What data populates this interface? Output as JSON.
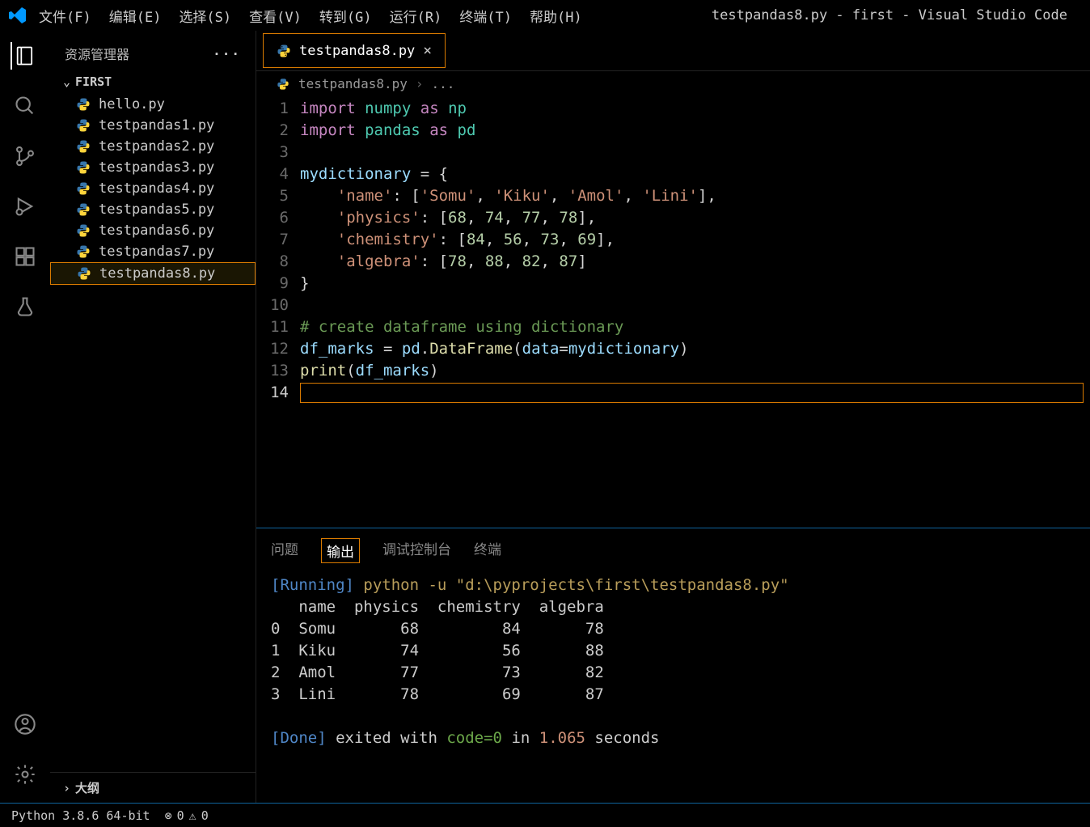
{
  "menubar": {
    "items": [
      "文件(F)",
      "编辑(E)",
      "选择(S)",
      "查看(V)",
      "转到(G)",
      "运行(R)",
      "终端(T)",
      "帮助(H)"
    ],
    "title": "testpandas8.py - first - Visual Studio Code"
  },
  "sidebar": {
    "header": "资源管理器",
    "more": "···",
    "folder": "FIRST",
    "files": [
      "hello.py",
      "testpandas1.py",
      "testpandas2.py",
      "testpandas3.py",
      "testpandas4.py",
      "testpandas5.py",
      "testpandas6.py",
      "testpandas7.py",
      "testpandas8.py"
    ],
    "selected_index": 8,
    "outline": "大纲"
  },
  "tabs": {
    "active": "testpandas8.py"
  },
  "breadcrumb": {
    "file": "testpandas8.py",
    "rest": "..."
  },
  "editor": {
    "lines": [
      {
        "n": "1",
        "html": "<span class='kw'>import</span> <span class='id'>numpy</span> <span class='kw'>as</span> <span class='id'>np</span>"
      },
      {
        "n": "2",
        "html": "<span class='kw'>import</span> <span class='id'>pandas</span> <span class='kw'>as</span> <span class='id'>pd</span>"
      },
      {
        "n": "3",
        "html": ""
      },
      {
        "n": "4",
        "html": "<span class='id2'>mydictionary</span> <span class='op'>=</span> {"
      },
      {
        "n": "5",
        "html": "    <span class='str'>'name'</span>: [<span class='str'>'Somu'</span>, <span class='str'>'Kiku'</span>, <span class='str'>'Amol'</span>, <span class='str'>'Lini'</span>],"
      },
      {
        "n": "6",
        "html": "    <span class='str'>'physics'</span>: [<span class='num'>68</span>, <span class='num'>74</span>, <span class='num'>77</span>, <span class='num'>78</span>],"
      },
      {
        "n": "7",
        "html": "    <span class='str'>'chemistry'</span>: [<span class='num'>84</span>, <span class='num'>56</span>, <span class='num'>73</span>, <span class='num'>69</span>],"
      },
      {
        "n": "8",
        "html": "    <span class='str'>'algebra'</span>: [<span class='num'>78</span>, <span class='num'>88</span>, <span class='num'>82</span>, <span class='num'>87</span>]"
      },
      {
        "n": "9",
        "html": "}"
      },
      {
        "n": "10",
        "html": ""
      },
      {
        "n": "11",
        "html": "<span class='com'># create dataframe using dictionary</span>"
      },
      {
        "n": "12",
        "html": "<span class='id2'>df_marks</span> <span class='op'>=</span> <span class='id2'>pd</span>.<span class='fn'>DataFrame</span>(<span class='id2'>data</span>=<span class='id2'>mydictionary</span>)"
      },
      {
        "n": "13",
        "html": "<span class='fn'>print</span>(<span class='id2'>df_marks</span>)"
      },
      {
        "n": "14",
        "html": "",
        "current": true
      }
    ]
  },
  "panel": {
    "tabs": [
      "问题",
      "输出",
      "调试控制台",
      "终端"
    ],
    "active_index": 1,
    "running_label": "[Running]",
    "command": "python -u \"d:\\pyprojects\\first\\testpandas8.py\"",
    "table_header": "   name  physics  chemistry  algebra",
    "rows": [
      "0  Somu       68         84       78",
      "1  Kiku       74         56       88",
      "2  Amol       77         73       82",
      "3  Lini       78         69       87"
    ],
    "done_label": "[Done]",
    "done_text1": " exited with ",
    "done_code": "code=0",
    "done_text2": " in ",
    "done_time": "1.065",
    "done_text3": " seconds"
  },
  "statusbar": {
    "python": "Python 3.8.6 64-bit",
    "errors": "0",
    "warnings": "0"
  }
}
